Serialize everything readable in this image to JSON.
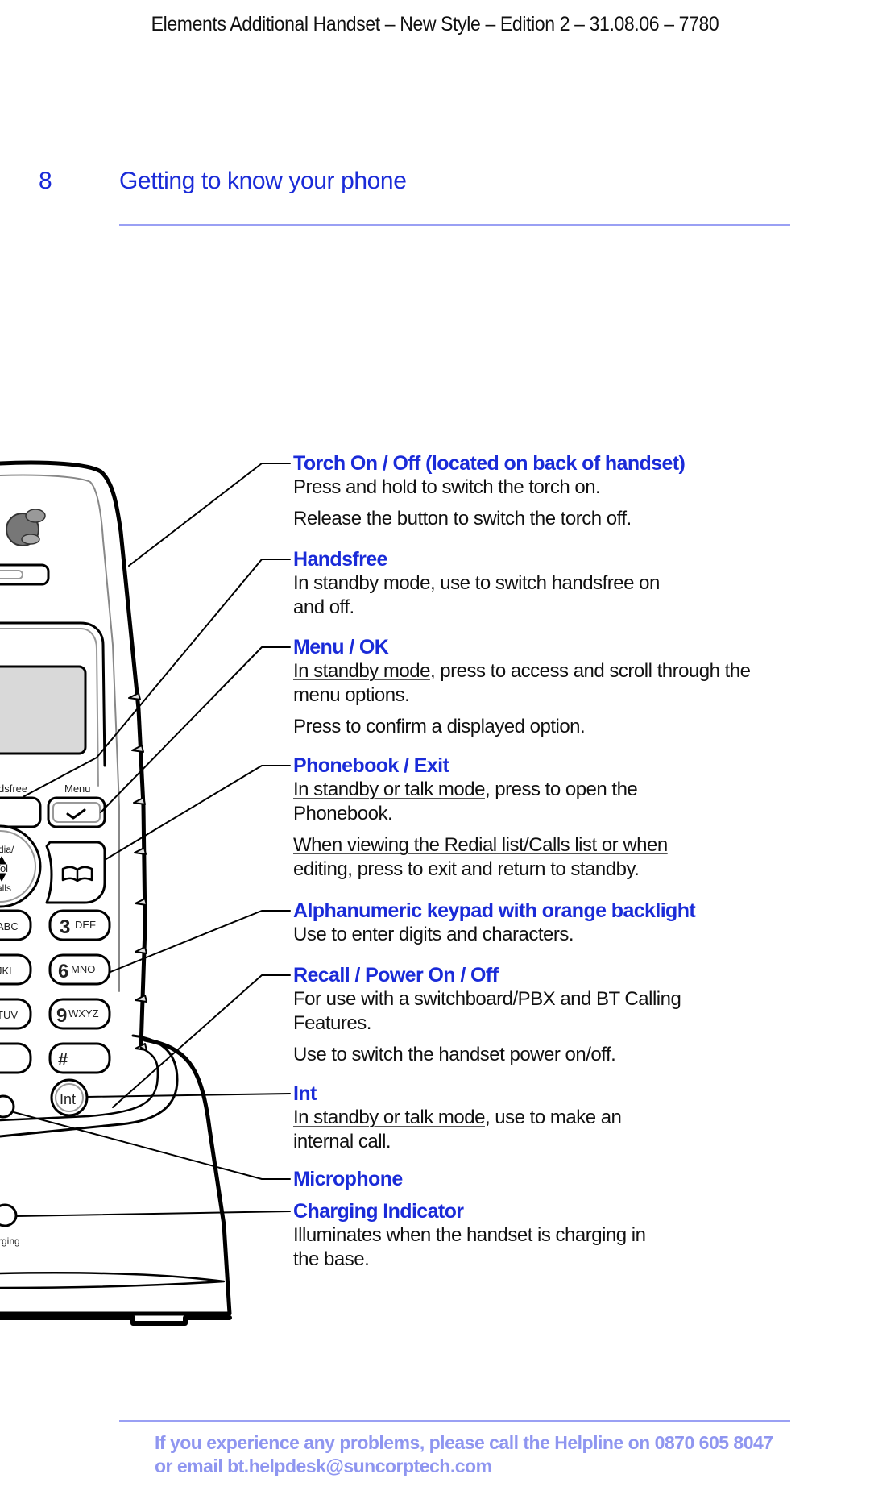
{
  "running_head": "Elements Additional Handset – New Style – Edition 2 – 31.08.06 – 7780",
  "page_number": "8",
  "section_title": "Getting to know your phone",
  "colors": {
    "accent_blue": "#1a2bd8",
    "rule_blue": "#9aa0f4",
    "footer_blue": "#8f96f0"
  },
  "phone_labels": {
    "handsfree": "dsfree",
    "menu": "Menu",
    "redial_top": "dia/",
    "vol": "Vol",
    "calls": "alls",
    "key3": "3",
    "key3_letters": "DEF",
    "key6": "6",
    "key6_letters": "MNO",
    "key9": "9",
    "key9_letters": "WXYZ",
    "key_abc": "ABC",
    "key_jkl": "JKL",
    "key_tuv": "TUV",
    "hash": "#",
    "int": "Int",
    "charging": "rging"
  },
  "callouts": [
    {
      "title": "Torch On / Off (located on back of handset)",
      "paragraphs": [
        [
          {
            "t": "Press "
          },
          {
            "t": "and hold",
            "u": true
          },
          {
            "t": " to switch the torch on."
          }
        ],
        [
          {
            "t": "Release the button to switch the torch off."
          }
        ]
      ]
    },
    {
      "title": "Handsfree",
      "paragraphs": [
        [
          {
            "t": "In standby mode,",
            "u": true
          },
          {
            "t": " use to switch handsfree on and off."
          }
        ]
      ]
    },
    {
      "title": "Menu / OK",
      "paragraphs": [
        [
          {
            "t": "In standby mode",
            "u": true
          },
          {
            "t": ", press to access and scroll through the menu options."
          }
        ],
        [
          {
            "t": "Press to confirm a displayed option."
          }
        ]
      ]
    },
    {
      "title": "Phonebook / Exit",
      "paragraphs": [
        [
          {
            "t": "In standby or talk mode",
            "u": true
          },
          {
            "t": ", press to open the Phonebook."
          }
        ],
        [
          {
            "t": "When viewing the Redial list/Calls list or when editing",
            "u": true
          },
          {
            "t": ", press to exit and return to standby."
          }
        ]
      ]
    },
    {
      "title": "Alphanumeric keypad with orange backlight",
      "paragraphs": [
        [
          {
            "t": "Use to enter digits and characters."
          }
        ]
      ]
    },
    {
      "title": "Recall / Power On / Off",
      "paragraphs": [
        [
          {
            "t": "For use with a switchboard/PBX and BT Calling Features."
          }
        ],
        [
          {
            "t": "Use to switch the handset power on/off."
          }
        ]
      ]
    },
    {
      "title": "Int",
      "paragraphs": [
        [
          {
            "t": "In standby or talk mode",
            "u": true
          },
          {
            "t": ", use to make an internal call."
          }
        ]
      ]
    },
    {
      "title": "Microphone",
      "paragraphs": []
    },
    {
      "title": "Charging Indicator",
      "paragraphs": [
        [
          {
            "t": "Illuminates when the handset is charging in the base."
          }
        ]
      ]
    }
  ],
  "footer": {
    "line1": "If you experience any problems, please call the Helpline on 0870 605 8047",
    "line2": "or email bt.helpdesk@suncorptech.com"
  }
}
